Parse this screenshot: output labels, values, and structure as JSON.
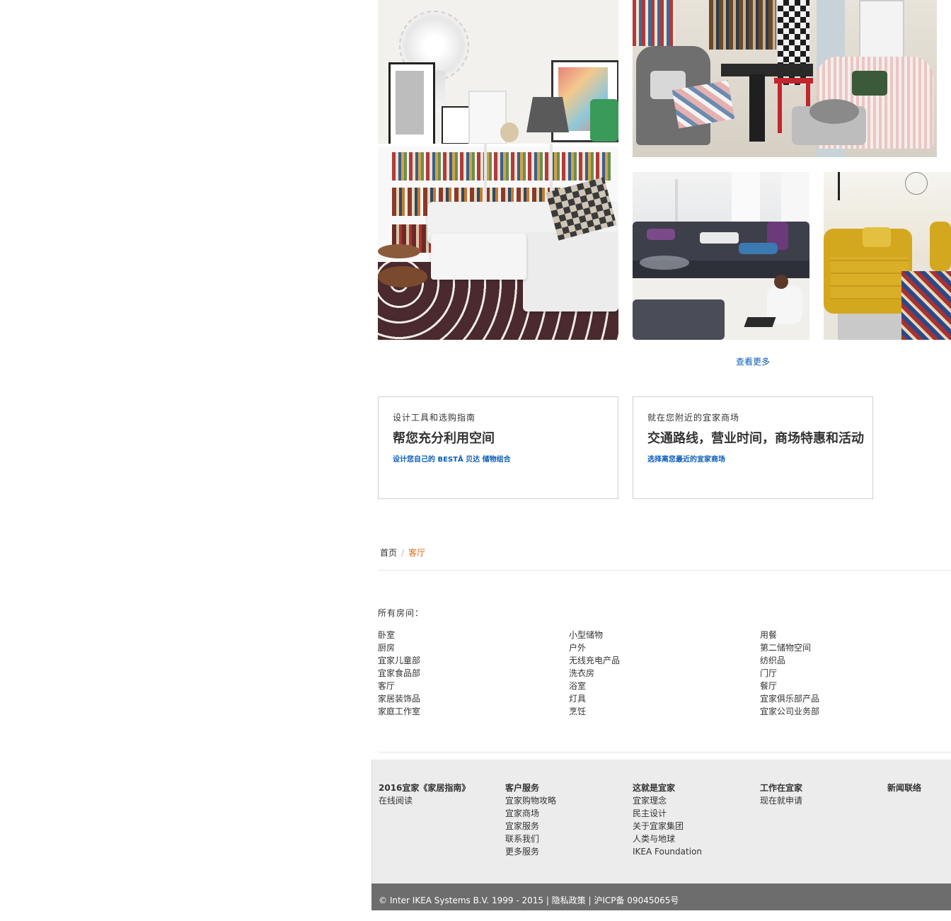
{
  "gallery": {
    "more_link": "查看更多"
  },
  "promos": [
    {
      "eyebrow": "设计工具和选购指南",
      "headline": "帮您充分利用空间",
      "cta": "设计您自己的 BESTÅ 贝达 储物组合"
    },
    {
      "eyebrow": "就在您附近的宜家商场",
      "headline": "交通路线，营业时间，商场特惠和活动",
      "cta": "选择离您最近的宜家商场"
    }
  ],
  "breadcrumb": {
    "home": "首页",
    "separator": "/",
    "current": "客厅"
  },
  "rooms": {
    "title": "所有房间：",
    "columns": [
      [
        "卧室",
        "厨房",
        "宜家儿童部",
        "宜家食品部",
        "客厅",
        "家居装饰品",
        "家庭工作室"
      ],
      [
        "小型储物",
        "户外",
        "无线充电产品",
        "洗衣房",
        "浴室",
        "灯具",
        "烹饪"
      ],
      [
        "用餐",
        "第二储物空间",
        "纺织品",
        "门厅",
        "餐厅",
        "宜家俱乐部产品",
        "宜家公司业务部"
      ]
    ]
  },
  "footer": {
    "columns": [
      {
        "heading": "2016宜家《家居指南》",
        "links": [
          "在线阅读"
        ]
      },
      {
        "heading": "客户服务",
        "links": [
          "宜家购物攻略",
          "宜家商场",
          "宜家服务",
          "联系我们",
          "更多服务"
        ]
      },
      {
        "heading": "这就是宜家",
        "links": [
          "宜家理念",
          "民主设计",
          "关于宜家集团",
          "人类与地球",
          "IKEA Foundation"
        ]
      },
      {
        "heading": "工作在宜家",
        "links": [
          "现在就申请"
        ]
      },
      {
        "heading": "新闻联络",
        "links": []
      }
    ],
    "copyright": "© Inter IKEA Systems B.V. 1999 - 2015 | 隐私政策 | 沪ICP备 09045065号"
  },
  "colors": {
    "link_blue": "#0a5db8",
    "breadcrumb_active": "#e0691a",
    "footer_bg": "#ececec",
    "bottombar_bg": "#6d6d6d"
  }
}
